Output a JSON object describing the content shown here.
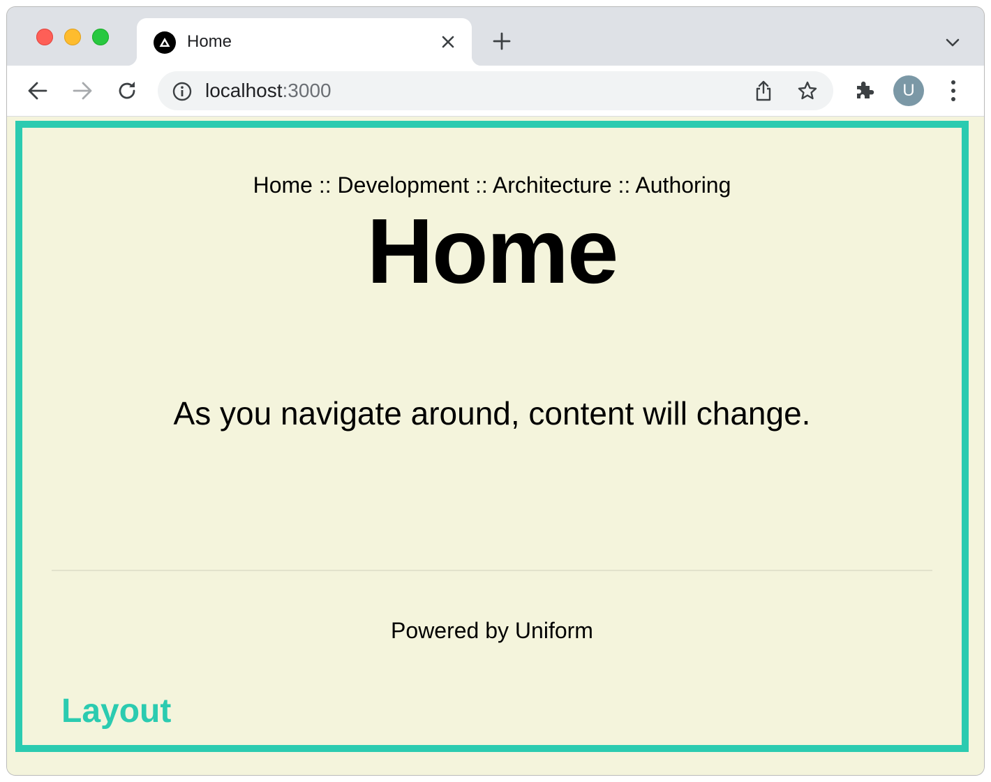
{
  "browser": {
    "tab": {
      "title": "Home"
    },
    "address_bar": {
      "host": "localhost",
      "port": ":3000"
    },
    "profile_initial": "U",
    "icons": {
      "favicon": "triangle-logo-icon",
      "close_tab": "close-icon",
      "new_tab": "plus-icon",
      "tab_menu": "chevron-down-icon",
      "back": "arrow-left-icon",
      "forward": "arrow-right-icon",
      "reload": "reload-icon",
      "site_info": "info-icon",
      "share": "share-icon",
      "bookmark": "star-icon",
      "extensions": "puzzle-icon",
      "menu": "kebab-menu-icon"
    }
  },
  "page": {
    "breadcrumb": "Home :: Development :: Architecture :: Authoring",
    "title": "Home",
    "lead": "As you navigate around, content will change.",
    "footer": "Powered by Uniform",
    "layout_label": "Layout",
    "colors": {
      "background": "#f4f4dc",
      "accent": "#2bcbb0"
    }
  }
}
